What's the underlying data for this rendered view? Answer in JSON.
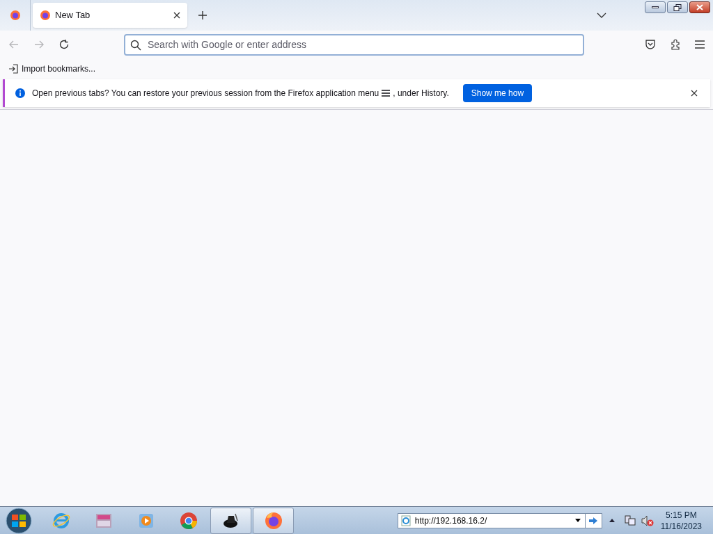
{
  "tabs": [
    {
      "title": "New Tab",
      "selected": true
    }
  ],
  "urlbar": {
    "placeholder": "Search with Google or enter address"
  },
  "bookmarks": [
    "Import bookmarks..."
  ],
  "notification": {
    "message_start": "Open previous tabs? You can restore your previous session from the Firefox application menu",
    "message_end": ", under History.",
    "button": "Show me how"
  },
  "taskbar": {
    "apps": [
      {
        "kind": "ie",
        "selected": false
      },
      {
        "kind": "archive",
        "selected": false
      },
      {
        "kind": "media",
        "selected": false
      },
      {
        "kind": "chrome",
        "selected": false
      },
      {
        "kind": "hat",
        "selected": true
      },
      {
        "kind": "firefox",
        "selected": true
      }
    ],
    "address": "http://192.168.16.2/",
    "time": "5:15 PM",
    "date": "11/16/2023"
  }
}
